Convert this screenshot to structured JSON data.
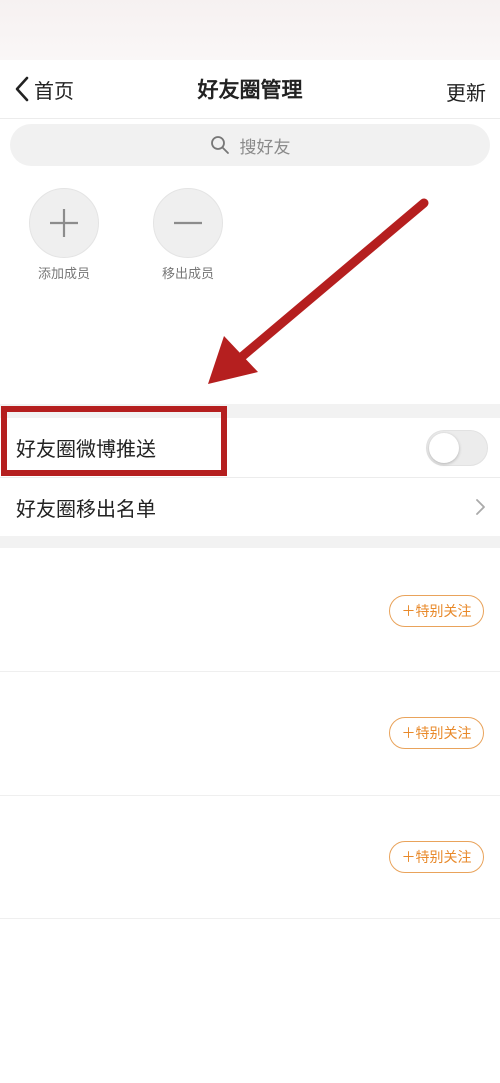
{
  "nav": {
    "back_label": "首页",
    "title": "好友圈管理",
    "update_label": "更新"
  },
  "search": {
    "placeholder": "搜好友"
  },
  "members": {
    "add_label": "添加成员",
    "remove_label": "移出成员"
  },
  "settings": {
    "push_label": "好友圈微博推送",
    "push_enabled": false,
    "removed_list_label": "好友圈移出名单"
  },
  "list": {
    "follow_labels": [
      "＋特别关注",
      "＋特别关注",
      "＋特别关注"
    ]
  },
  "colors": {
    "accent_orange": "#e8892a",
    "annotation_red": "#b51f1f"
  }
}
